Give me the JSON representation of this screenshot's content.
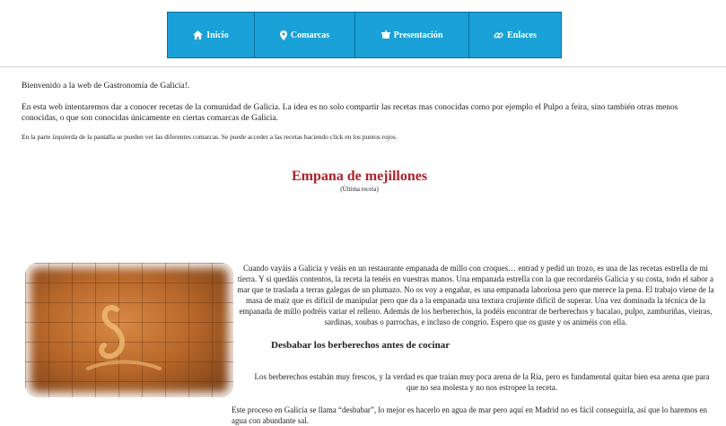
{
  "nav": {
    "items": [
      {
        "label": "Inicio",
        "icon": "home-icon"
      },
      {
        "label": "Comarcas",
        "icon": "map-marker-icon"
      },
      {
        "label": "Presentación",
        "icon": "pot-icon"
      },
      {
        "label": "Enlaces",
        "icon": "link-icon"
      }
    ],
    "bg_color": "#1aa1d8"
  },
  "intro": {
    "welcome": "Bienvenido a la web de Gastronomía de Galicia!.",
    "description": "En esta web intentaremos dar a conocer recetas de la comunidad de Galicia. La idea es no solo compartir las recetas mas conocidas como por ejemplo el Pulpo a feira, sino también otras menos conocidas, o que son conocidas únicamente en ciertas comarcas de Galicia.",
    "hint": "En la parte izquierda de la pantalla se pueden ver las diferentes comarcas. Se puede acceder a las recetas haciendo click en los puntos rojos."
  },
  "recipe": {
    "title": "Empana de mejillones",
    "subtitle": "(Última receta)",
    "title_color": "#b0202a",
    "body": "Cuando vayáis a Galicia y veáis en un restaurante empanada de millo con croques… entrad y pedid un trozo, es una de las recetas estrella de mi tierra. Y si quedáis contentos, la receta la tenéis en vuestras manos. Una empanada estrella con la que recordaréis Galicia y su costa, todo el sabor a mar que te traslada a terras galegas de un plumazo. No os voy a engañar, es una empanada laboriosa pero que merece la pena. El trabajo viene de la masa de maíz que es difícil de manipular pero que da a la empanada una textura crujiente difícil de superar. Una vez dominada la técnica de la empanada de millo podréis variar el relleno. Además de los berberechos, la podéis encontrar de berberechos y bacalao, pulpo, zamburiñas, vieiras, sardinas, xoubas o parrochas, e incluso de congrio. Espero que os guste y os animéis con ella.",
    "section_title": "Desbabar los berberechos antes de cocinar",
    "section_text": "Los berberechos estabán muy frescos, y la verdad es que traían muy poca arena de la Ría, pero es fundamental quitar bien esa arena que para que no sea molesta y no nos estropee la receta.",
    "last_text": "Este proceso en Galicia se llama “desbabar”, lo mejor es hacerlo en agua de mar pero aquí en Madrid no es fácil conseguirla, así que lo haremos en agua con abundante sal."
  }
}
